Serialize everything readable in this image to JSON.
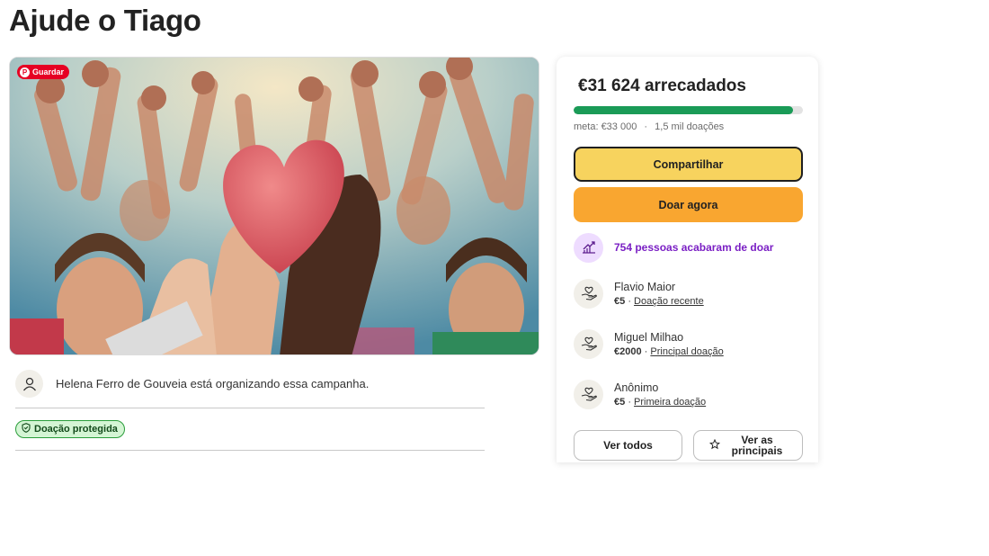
{
  "page": {
    "title": "Ajude o Tiago"
  },
  "hero": {
    "save_label": "Guardar",
    "save_icon_letter": "P"
  },
  "organizer": {
    "text": "Helena Ferro de Gouveia está organizando essa campanha."
  },
  "protection": {
    "badge_label": "Doação protegida"
  },
  "sidebar": {
    "raised_text": "€31 624 arrecadados",
    "progress_fraction": 0.958,
    "meta_goal": "meta: €33 000",
    "meta_separator": "·",
    "meta_count": "1,5 mil doações",
    "share_label": "Compartilhar",
    "donate_label": "Doar agora",
    "recent_text": "754 pessoas acabaram de doar",
    "donations": [
      {
        "name": "Flavio Maior",
        "amount": "€5",
        "separator": "·",
        "tag": "Doação recente"
      },
      {
        "name": "Miguel Milhao",
        "amount": "€2000",
        "separator": "·",
        "tag": "Principal doação"
      },
      {
        "name": "Anônimo",
        "amount": "€5",
        "separator": "·",
        "tag": "Primeira doação"
      }
    ],
    "see_all_label": "Ver todos",
    "see_top_label": "Ver as principais"
  },
  "colors": {
    "progress": "#1a9b57",
    "share_button": "#f7d35e",
    "donate_button": "#f9a630",
    "recent_text": "#7a1fc4",
    "protected_badge_bg": "#d4f5d4",
    "pinterest": "#e60023"
  },
  "icons": {
    "organizer": "user-icon",
    "protected": "shield-icon",
    "recent": "trending-up-icon",
    "donor": "hand-heart-icon",
    "top": "star-icon"
  }
}
